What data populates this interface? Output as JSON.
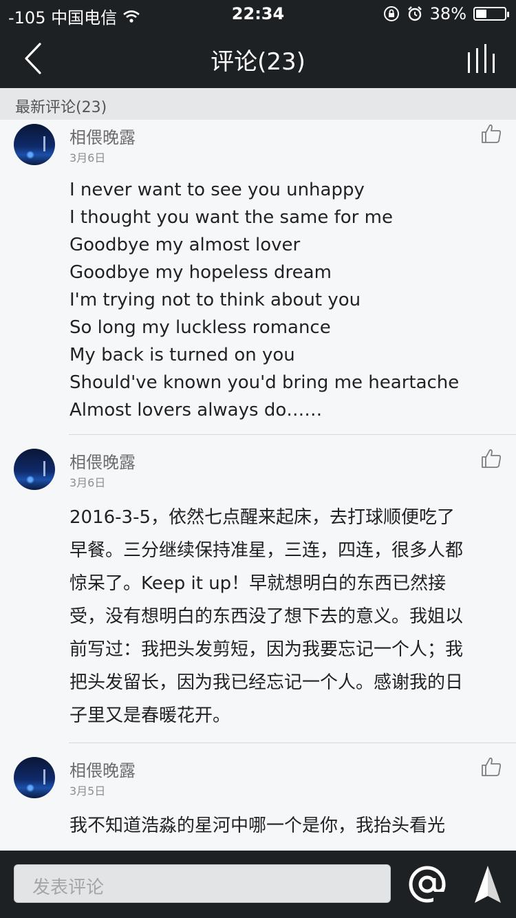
{
  "status_bar": {
    "carrier": "-105 中国电信",
    "time": "22:34",
    "battery": "38%",
    "battery_level": 0.38
  },
  "nav": {
    "title": "评论(23)"
  },
  "section": {
    "title": "最新评论(23)"
  },
  "comments": [
    {
      "author": "相偎晚露",
      "date": "3月6日",
      "lines": [
        "I never want to see you unhappy",
        "I thought you want the same for me",
        "Goodbye my almost lover",
        "Goodbye my hopeless dream",
        "I'm trying not to think about you",
        "So long my luckless romance",
        "My back is turned on you",
        "Should've known you'd bring me heartache",
        "Almost lovers always do……"
      ]
    },
    {
      "author": "相偎晚露",
      "date": "3月6日",
      "lines": [
        "2016-3-5，依然七点醒来起床，去打球顺便吃了",
        "早餐。三分继续保持准星，三连，四连，很多人都",
        "惊呆了。Keep it up！早就想明白的东西已然接",
        "受，没有想明白的东西没了想下去的意义。我姐以",
        "前写过：我把头发剪短，因为我要忘记一个人；我",
        "把头发留长，因为我已经忘记一个人。感谢我的日",
        "子里又是春暖花开。"
      ]
    },
    {
      "author": "相偎晚露",
      "date": "3月5日",
      "lines": [
        "我不知道浩淼的星河中哪一个是你，我抬头看光"
      ]
    }
  ],
  "bottom_bar": {
    "input_placeholder": "发表评论"
  },
  "icons": {
    "back": "chevron-left-icon",
    "menu": "bars-icon",
    "like": "thumbs-up-icon",
    "mention": "at-icon",
    "send": "send-arrow-icon"
  }
}
